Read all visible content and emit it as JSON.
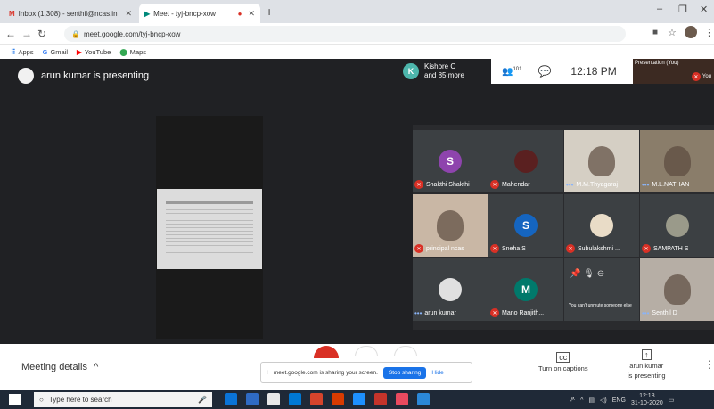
{
  "browser": {
    "tabs": [
      {
        "title": "Inbox (1,308) - senthil@ncas.in",
        "close": "✕"
      },
      {
        "title": "Meet - tyj-bncp-xow",
        "close": "✕"
      }
    ],
    "new_tab": "+",
    "window": {
      "minimize": "–",
      "restore": "❐",
      "close": "✕"
    },
    "url": "meet.google.com/tyj-bncp-xow",
    "bookmarks": [
      "Apps",
      "Gmail",
      "YouTube",
      "Maps"
    ]
  },
  "meet": {
    "presenting_text": "arun kumar is presenting",
    "participants_summary": {
      "initial": "K",
      "line1": "Kishore C",
      "line2": "and 85 more"
    },
    "people_count": "101",
    "time": "12:18 PM",
    "presentation_label": "Presentation (You)",
    "you_label": "You",
    "tiles": [
      {
        "name": "Shakthi Shakthi",
        "initial": "S",
        "color": "#8e44ad"
      },
      {
        "name": "Mahendar",
        "initial": "",
        "color": ""
      },
      {
        "name": "M.M.Thyagaraj",
        "initial": "",
        "color": ""
      },
      {
        "name": "M.L.NATHAN",
        "initial": "",
        "color": ""
      },
      {
        "name": "principal ncas",
        "initial": "",
        "color": ""
      },
      {
        "name": "Sneha S",
        "initial": "S",
        "color": "#1565c0"
      },
      {
        "name": "Subulakshmi ...",
        "initial": "",
        "color": ""
      },
      {
        "name": "SAMPATH S",
        "initial": "",
        "color": ""
      },
      {
        "name": "arun kumar",
        "initial": "",
        "color": ""
      },
      {
        "name": "Mano Ranjith...",
        "initial": "M",
        "color": "#00796b"
      },
      {
        "name": "",
        "initial": "",
        "color": ""
      },
      {
        "name": "Senthil D",
        "initial": "",
        "color": ""
      }
    ],
    "tooltip": "You can't unmute someone else"
  },
  "bottom": {
    "meeting_details": "Meeting details",
    "share_text": "meet.google.com is sharing your screen.",
    "stop_sharing": "Stop sharing",
    "hide": "Hide",
    "captions": "Turn on captions",
    "presenter_line1": "arun kumar",
    "presenter_line2": "is presenting"
  },
  "taskbar": {
    "search_placeholder": "Type here to search",
    "lang": "ENG",
    "clock_time": "12:18",
    "clock_date": "31-10-2020"
  }
}
